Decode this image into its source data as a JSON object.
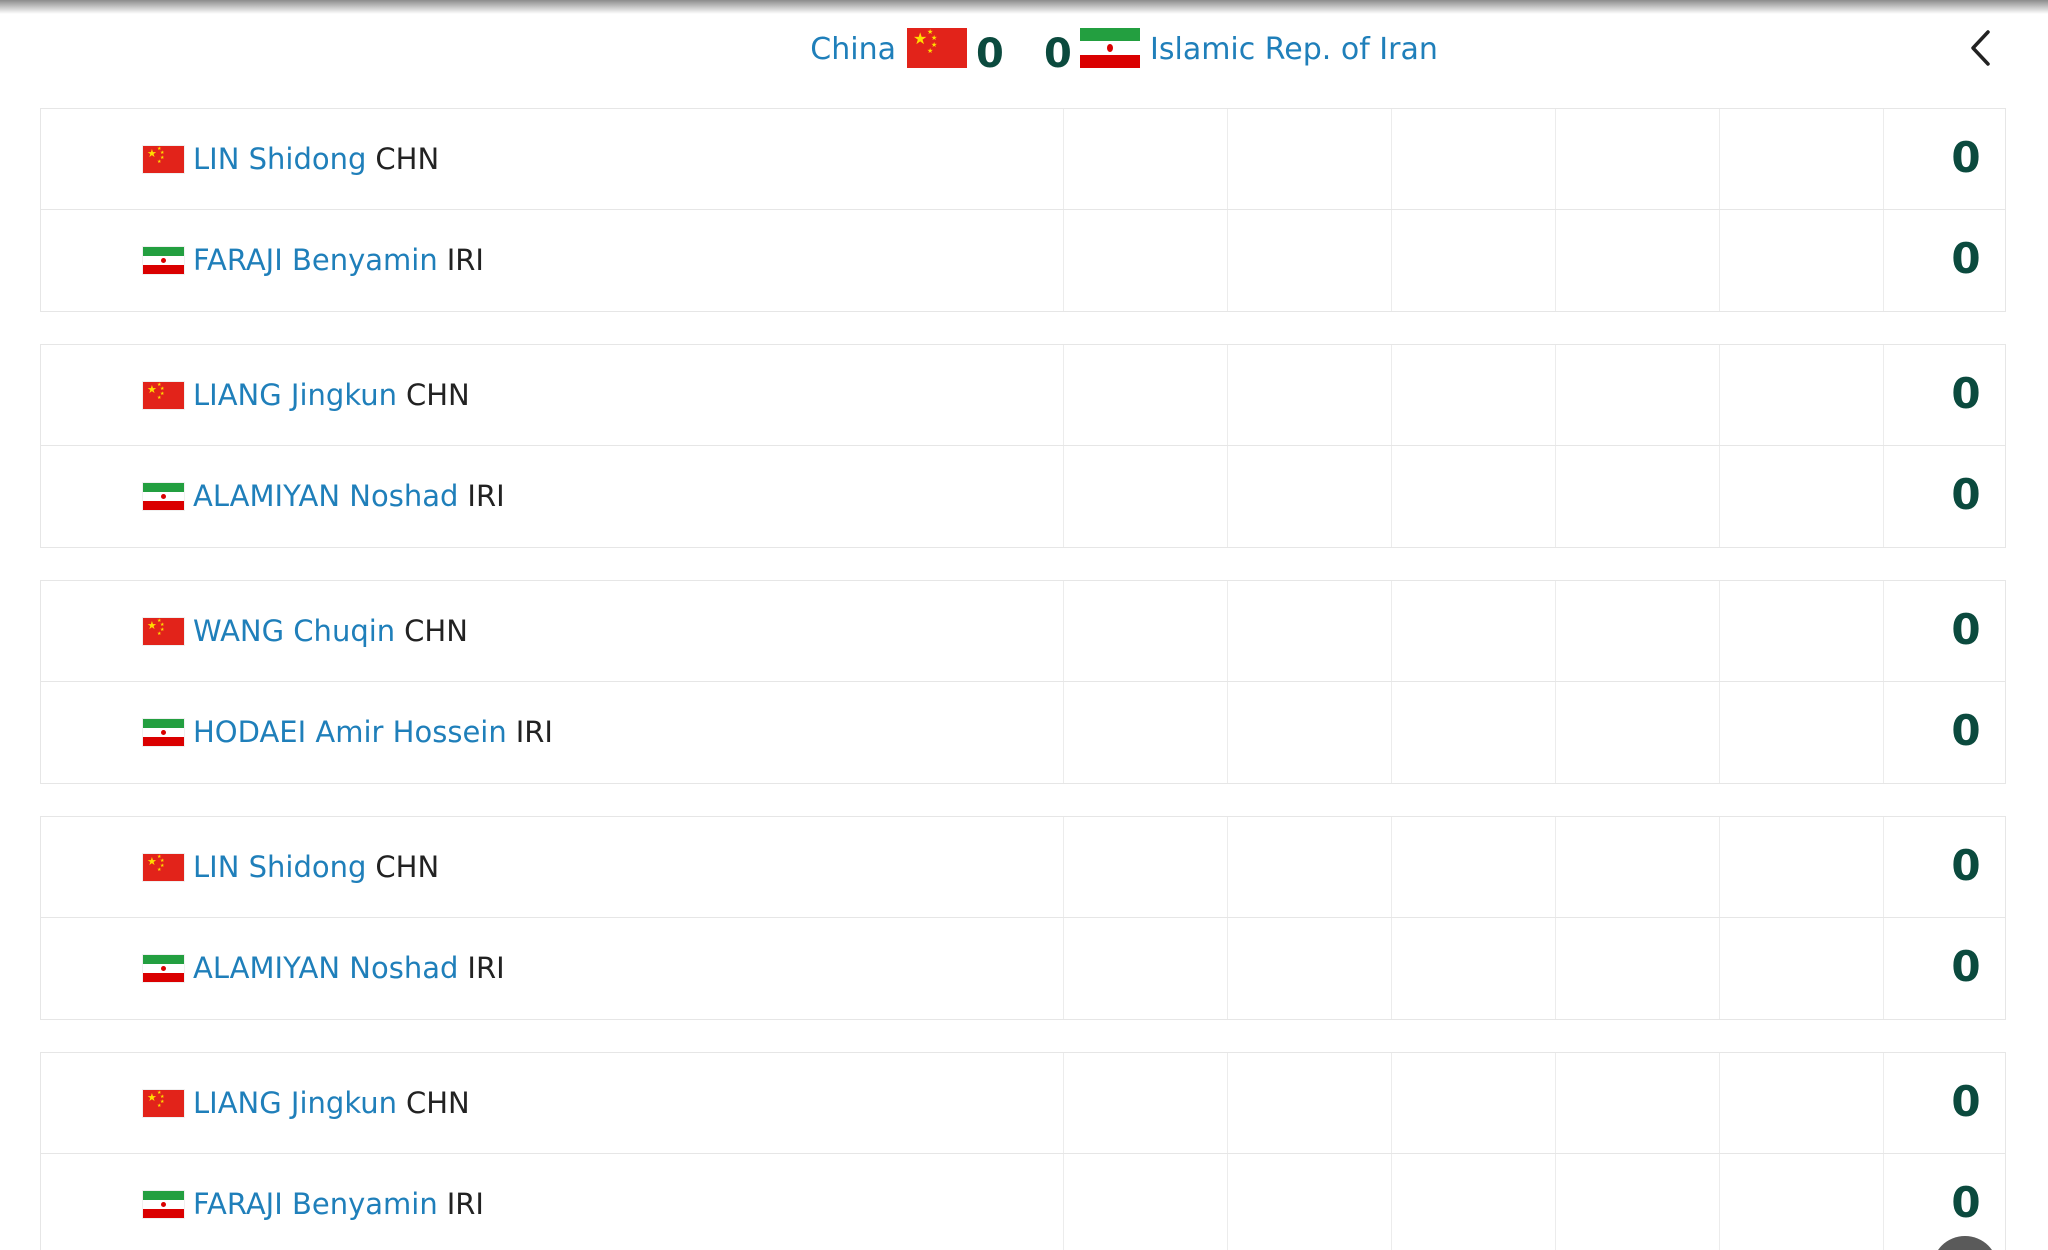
{
  "header": {
    "team_a": {
      "name": "China",
      "score": "0"
    },
    "team_b": {
      "name": "Islamic Rep. of Iran",
      "score": "0"
    },
    "back_icon": "chevron-left-icon"
  },
  "matches": [
    {
      "rows": [
        {
          "name": "LIN Shidong",
          "country": "CHN",
          "flag": "china-flag-icon",
          "total": "0"
        },
        {
          "name": "FARAJI Benyamin",
          "country": "IRI",
          "flag": "iran-flag-icon",
          "total": "0"
        }
      ]
    },
    {
      "rows": [
        {
          "name": "LIANG Jingkun",
          "country": "CHN",
          "flag": "china-flag-icon",
          "total": "0"
        },
        {
          "name": "ALAMIYAN Noshad",
          "country": "IRI",
          "flag": "iran-flag-icon",
          "total": "0"
        }
      ]
    },
    {
      "rows": [
        {
          "name": "WANG Chuqin",
          "country": "CHN",
          "flag": "china-flag-icon",
          "total": "0"
        },
        {
          "name": "HODAEI Amir Hossein",
          "country": "IRI",
          "flag": "iran-flag-icon",
          "total": "0"
        }
      ]
    },
    {
      "rows": [
        {
          "name": "LIN Shidong",
          "country": "CHN",
          "flag": "china-flag-icon",
          "total": "0"
        },
        {
          "name": "ALAMIYAN Noshad",
          "country": "IRI",
          "flag": "iran-flag-icon",
          "total": "0"
        }
      ]
    },
    {
      "rows": [
        {
          "name": "LIANG Jingkun",
          "country": "CHN",
          "flag": "china-flag-icon",
          "total": "0"
        },
        {
          "name": "FARAJI Benyamin",
          "country": "IRI",
          "flag": "iran-flag-icon",
          "total": "0"
        }
      ]
    }
  ],
  "colors": {
    "link": "#1f7fba",
    "score": "#0b4a3e",
    "cn_red": "#e2231a",
    "ir_green": "#239f40",
    "ir_red": "#da0000"
  }
}
